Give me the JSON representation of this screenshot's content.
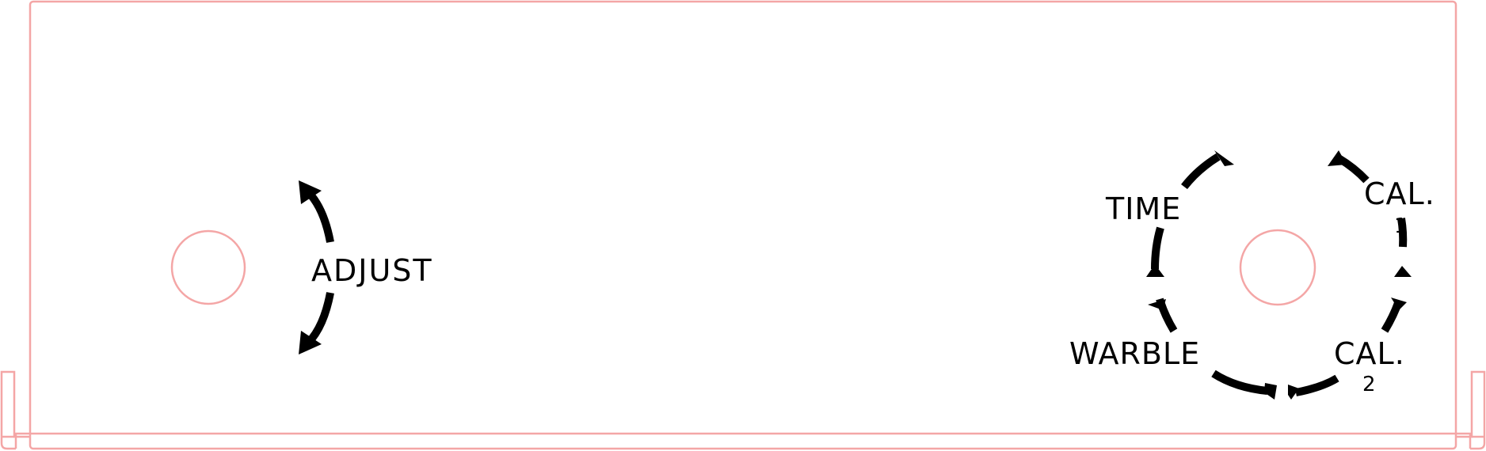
{
  "panel": {
    "outline_color": "#f4a6a6",
    "ink_color": "#000000"
  },
  "adjust": {
    "label": "ADJUST"
  },
  "selector": {
    "positions": [
      {
        "label": "TIME",
        "sub": ""
      },
      {
        "label": "CAL.",
        "sub": "1"
      },
      {
        "label": "CAL.",
        "sub": "2"
      },
      {
        "label": "WARBLE",
        "sub": ""
      }
    ]
  }
}
